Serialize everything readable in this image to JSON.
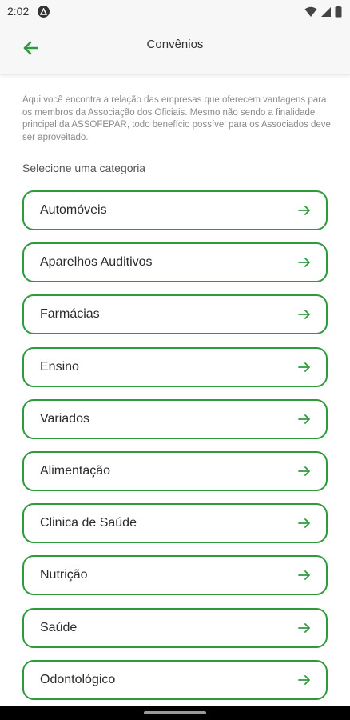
{
  "status_bar": {
    "time": "2:02"
  },
  "header": {
    "title": "Convênios",
    "back_icon": "arrow-left-icon"
  },
  "intro_text": "Aqui você encontra a relação das empresas que oferecem vantagens para os membros da Associação dos Oficiais. Mesmo não sendo a finalidade principal da ASSOFEPAR, todo benefício possível para os Associados deve ser aproveitado.",
  "section_label": "Selecione uma categoria",
  "categories": [
    {
      "label": "Automóveis"
    },
    {
      "label": "Aparelhos Auditivos"
    },
    {
      "label": "Farmácias"
    },
    {
      "label": "Ensino"
    },
    {
      "label": "Variados"
    },
    {
      "label": "Alimentação"
    },
    {
      "label": "Clinica de Saúde"
    },
    {
      "label": "Nutrição"
    },
    {
      "label": "Saúde"
    },
    {
      "label": "Odontológico"
    }
  ],
  "colors": {
    "accent": "#2e9a3c",
    "text": "#2b2b2b",
    "muted": "#8a8a8a"
  }
}
